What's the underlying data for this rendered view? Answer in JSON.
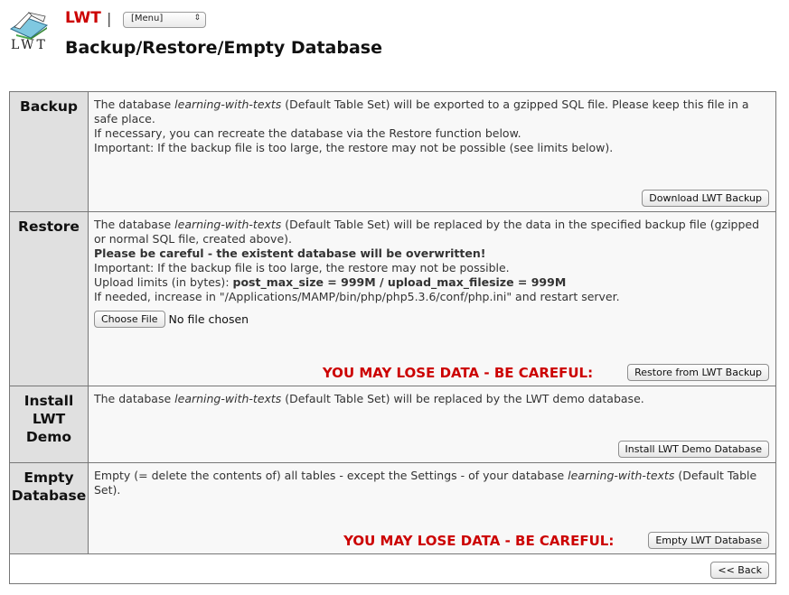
{
  "header": {
    "logo_text": "LWT",
    "brand": "LWT",
    "separator": "|",
    "menu_select_value": "[Menu]",
    "page_title": "Backup/Restore/Empty Database"
  },
  "backup": {
    "heading": "Backup",
    "line1_pre": "The database ",
    "db_name": "learning-with-texts",
    "line1_post": " (Default Table Set) will be exported to a gzipped SQL file. Please keep this file in a safe place.",
    "line2": "If necessary, you can recreate the database via the Restore function below.",
    "line3": "Important: If the backup file is too large, the restore may not be possible (see limits below).",
    "button": "Download LWT Backup"
  },
  "restore": {
    "heading": "Restore",
    "line1_pre": "The database ",
    "db_name": "learning-with-texts",
    "line1_post": " (Default Table Set) will be replaced by the data in the specified backup file (gzipped or normal SQL file, created above).",
    "line2": "Please be careful - the existent database will be overwritten!",
    "line3": "Important: If the backup file is too large, the restore may not be possible.",
    "line4_pre": "Upload limits (in bytes): ",
    "line4_bold": "post_max_size = 999M / upload_max_filesize = 999M",
    "line5": "If needed, increase in \"/Applications/MAMP/bin/php/php5.3.6/conf/php.ini\" and restart server.",
    "choose_file": "Choose File",
    "no_file": "No file chosen",
    "warning": "YOU MAY LOSE DATA - BE CAREFUL:",
    "button": "Restore from LWT Backup"
  },
  "install_demo": {
    "heading_l1": "Install",
    "heading_l2": "LWT",
    "heading_l3": "Demo",
    "line1_pre": "The database ",
    "db_name": "learning-with-texts",
    "line1_post": " (Default Table Set) will be replaced by the LWT demo database.",
    "button": "Install LWT Demo Database"
  },
  "empty_db": {
    "heading_l1": "Empty",
    "heading_l2": "Database",
    "line1_pre": "Empty (= delete the contents of) all tables - except the Settings - of your database ",
    "db_name": "learning-with-texts",
    "line1_post": " (Default Table Set).",
    "warning": "YOU MAY LOSE DATA - BE CAREFUL:",
    "button": "Empty LWT Database"
  },
  "footer": {
    "back_button": "<< Back"
  },
  "colors": {
    "brand": "#cc0000",
    "warning": "#cc0000",
    "header_cell": "#e0e0e0",
    "content_cell": "#f8f8f8"
  }
}
